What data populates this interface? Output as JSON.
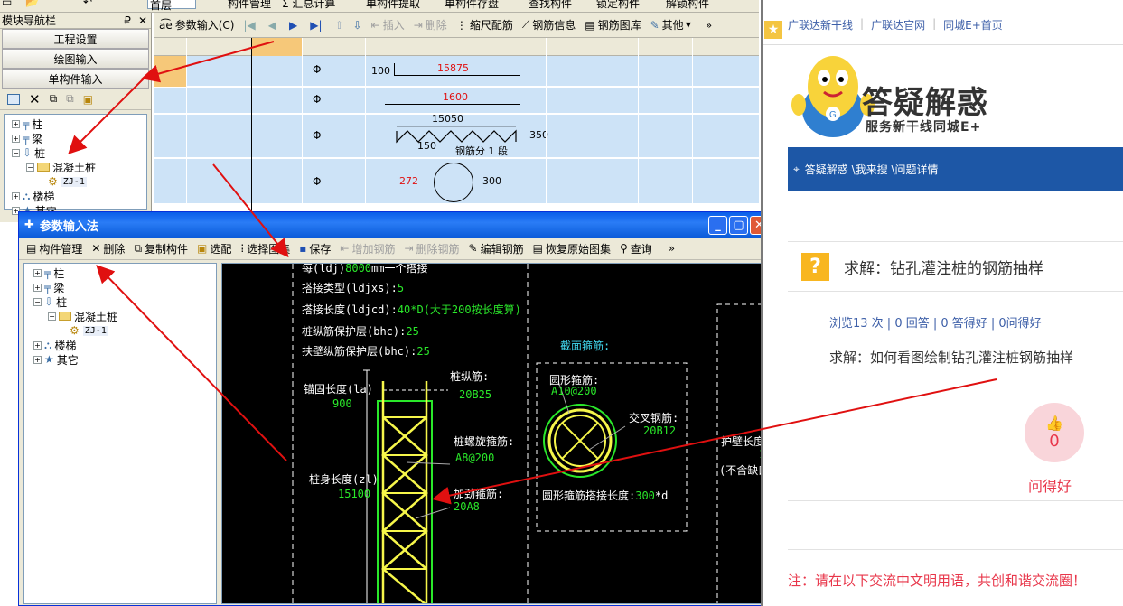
{
  "top_strip": {
    "items": [
      "首层",
      "构件管理",
      "汇总计算",
      "单构件提取",
      "单构件存盘",
      "查找构件",
      "锁定构件",
      "解锁构件"
    ]
  },
  "left_nav": {
    "title": "模块导航栏",
    "pin": "₽",
    "close": "✕",
    "buttons": [
      "工程设置",
      "绘图输入",
      "单构件输入"
    ],
    "tree": [
      {
        "label": "柱",
        "state": "+"
      },
      {
        "label": "梁",
        "state": "+"
      },
      {
        "label": "桩",
        "state": "−"
      },
      {
        "label": "混凝土桩",
        "state": "−"
      },
      {
        "label": "ZJ-1",
        "state": ""
      },
      {
        "label": "楼梯",
        "state": "+"
      },
      {
        "label": "其它",
        "state": "+"
      }
    ]
  },
  "main_toolbar": {
    "param_input": "参数输入(C)",
    "insert": "插入",
    "delete": "删除",
    "scale_rebar": "缩尺配筋",
    "rebar_info": "钢筋信息",
    "rebar_library": "钢筋图库",
    "other": "其他",
    "more": "»"
  },
  "grid": {
    "rows": [
      {
        "symbol": "Φ",
        "left_num": "100",
        "red_num": "15875"
      },
      {
        "symbol": "Φ",
        "red_num": "1600"
      },
      {
        "symbol": "Φ",
        "top_num": "15050",
        "right_num": "350",
        "bottom_num": "150",
        "note": "钢筋分 1 段"
      },
      {
        "symbol": "Φ",
        "red_num": "272",
        "right_num": "300"
      }
    ]
  },
  "dialog": {
    "title": "参数输入法",
    "toolbar": [
      "构件管理",
      "删除",
      "复制构件",
      "选配",
      "选择图集",
      "保存",
      "增加钢筋",
      "删除钢筋",
      "编辑钢筋",
      "恢复原始图集",
      "查询"
    ],
    "toolbar_more": "»",
    "tree": [
      {
        "label": "柱",
        "state": "+"
      },
      {
        "label": "梁",
        "state": "+"
      },
      {
        "label": "桩",
        "state": "−"
      },
      {
        "label": "混凝土桩",
        "state": "−"
      },
      {
        "label": "ZJ-1",
        "state": ""
      },
      {
        "label": "楼梯",
        "state": "+"
      },
      {
        "label": "其它",
        "state": "+"
      }
    ]
  },
  "drawing": {
    "line1_w": "每(ldj)",
    "line1_v": "8000",
    "line1_w2": "mm一个搭接",
    "lap_type_label": "搭接类型(ldjxs):",
    "lap_type_value": "5",
    "lap_len_label": "搭接长度(ldjcd):",
    "lap_len_value": "40*D(大于200按长度算)",
    "pile_cover_label": "桩纵筋保护层(bhc):",
    "pile_cover_value": "25",
    "wall_cover_label": "扶壁纵筋保护层(bhc):",
    "wall_cover_value": "25",
    "section_title": "截面箍筋:",
    "anchor_label": "锚固长度(la)",
    "anchor_value": "900",
    "long_bar_label": "桩纵筋:",
    "long_bar_value": "20B25",
    "spiral_label": "桩螺旋箍筋:",
    "spiral_value": "A8@200",
    "body_len_label": "桩身长度(zl)",
    "body_len_value": "15100",
    "stiff_label": "加劲箍筋:",
    "stiff_value": "20A8",
    "ring_label": "圆形箍筋:",
    "ring_value": "A10@200",
    "cross_label": "交叉钢筋:",
    "cross_value": "20B12",
    "ring_lap_label": "圆形箍筋搭接长度:",
    "ring_lap_value": "300",
    "ring_lap_unit": "*d",
    "wall_len_label": "护壁长度",
    "wall_len_value": "1(",
    "wall_note": "(不含缺口"
  },
  "web": {
    "bookmarks": [
      "广联达新干线",
      "广联达官网",
      "同城E+首页"
    ],
    "logo_title": "答疑解惑",
    "logo_sub": "服务新干线同城E+",
    "breadcrumb": "答疑解惑 \\我来搜 \\问题详情",
    "question_title": "求解：钻孔灌注桩的钢筋抽样",
    "stats": "浏览13 次 | 0 回答 | 0 答得好 | 0问得好",
    "question_body": "求解：如何看图绘制钻孔灌注桩钢筋抽样",
    "like_count": "0",
    "like_label": "问得好",
    "notice": "注：请在以下交流中文明用语，共创和谐交流圈！"
  },
  "colors": {
    "xp_blue": "#0a5ee9",
    "grid_sel": "#cde3f7",
    "arrow_red": "#e01010",
    "web_link": "#3d5fa8",
    "notice_red": "#e8364a"
  }
}
